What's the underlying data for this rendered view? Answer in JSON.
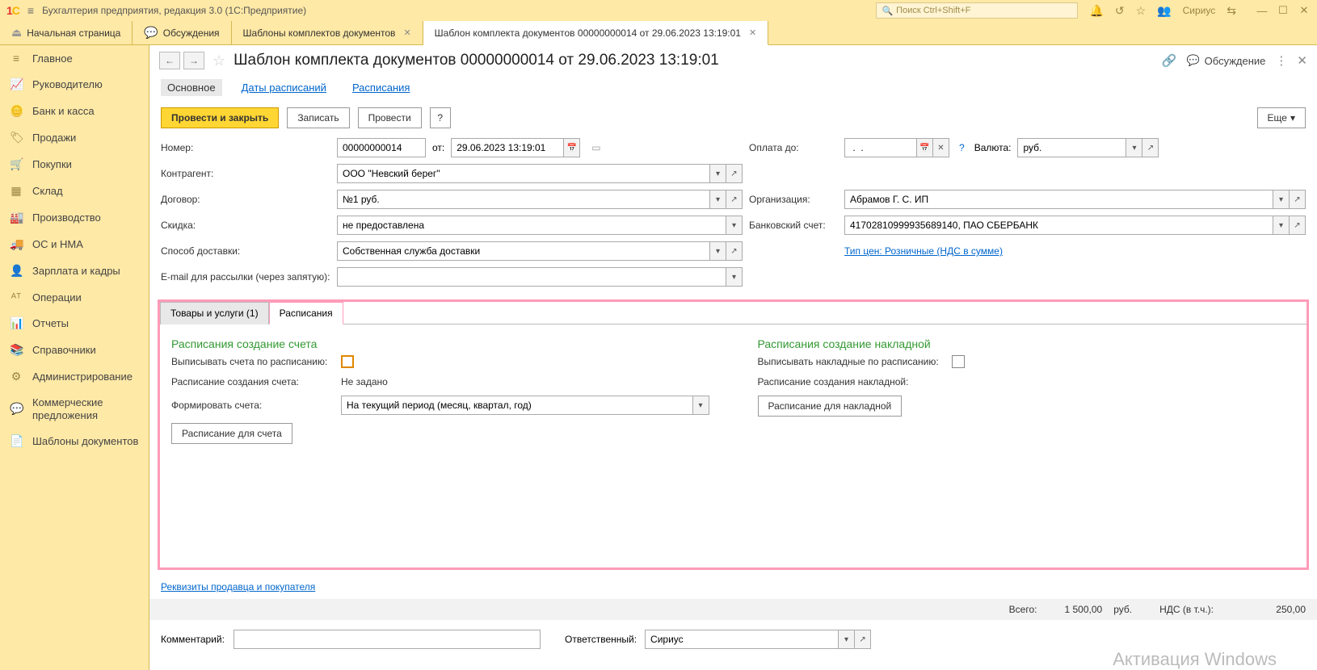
{
  "title": "Бухгалтерия предприятия, редакция 3.0  (1С:Предприятие)",
  "search_placeholder": "Поиск Ctrl+Shift+F",
  "username": "Сириус",
  "tabs": {
    "home": "Начальная страница",
    "discuss": "Обсуждения",
    "templates": "Шаблоны комплектов документов",
    "current": "Шаблон комплекта документов 00000000014 от 29.06.2023 13:19:01"
  },
  "sidebar": [
    "Главное",
    "Руководителю",
    "Банк и касса",
    "Продажи",
    "Покупки",
    "Склад",
    "Производство",
    "ОС и НМА",
    "Зарплата и кадры",
    "Операции",
    "Отчеты",
    "Справочники",
    "Администрирование",
    "Коммерческие предложения",
    "Шаблоны документов"
  ],
  "page_title": "Шаблон комплекта документов 00000000014 от 29.06.2023 13:19:01",
  "discuss_label": "Обсуждение",
  "subtabs": {
    "main": "Основное",
    "dates": "Даты расписаний",
    "sched": "Расписания"
  },
  "buttons": {
    "post_close": "Провести и закрыть",
    "save": "Записать",
    "post": "Провести",
    "help": "?",
    "more": "Еще"
  },
  "labels": {
    "number": "Номер:",
    "from": "от:",
    "counterparty": "Контрагент:",
    "contract": "Договор:",
    "discount": "Скидка:",
    "delivery": "Способ доставки:",
    "email": "E-mail для рассылки (через запятую):",
    "pay_until": "Оплата до:",
    "currency": "Валюта:",
    "org": "Организация:",
    "bank": "Банковский счет:",
    "price_type": "Тип цен: Розничные (НДС в сумме)"
  },
  "values": {
    "number": "00000000014",
    "date": "29.06.2023 13:19:01",
    "counterparty": "ООО \"Невский берег\"",
    "contract": "№1 руб.",
    "discount": "не предоставлена",
    "delivery": "Собственная служба доставки",
    "pay_until": " .  .",
    "currency": "руб.",
    "org": "Абрамов Г. С. ИП",
    "bank": "41702810999935689140, ПАО СБЕРБАНК"
  },
  "tabs2": {
    "goods": "Товары и услуги (1)",
    "sched": "Расписания"
  },
  "sched": {
    "inv_title": "Расписания создание счета",
    "inv_checkbox_label": "Выписывать счета по расписанию:",
    "inv_sched_label": "Расписание создания счета:",
    "inv_sched_value": "Не задано",
    "inv_form_label": "Формировать счета:",
    "inv_form_value": "На текущий период (месяц, квартал, год)",
    "inv_btn": "Расписание для счета",
    "wb_title": "Расписания создание накладной",
    "wb_checkbox_label": "Выписывать накладные по расписанию:",
    "wb_sched_label": "Расписание создания накладной:",
    "wb_btn": "Расписание для накладной"
  },
  "footer": {
    "link": "Реквизиты продавца и покупателя",
    "total_label": "Всего:",
    "total": "1 500,00",
    "currency": "руб.",
    "vat_label": "НДС (в т.ч.):",
    "vat": "250,00",
    "comment_label": "Комментарий:",
    "responsible_label": "Ответственный:",
    "responsible": "Сириус"
  },
  "watermark": "Активация Windows"
}
